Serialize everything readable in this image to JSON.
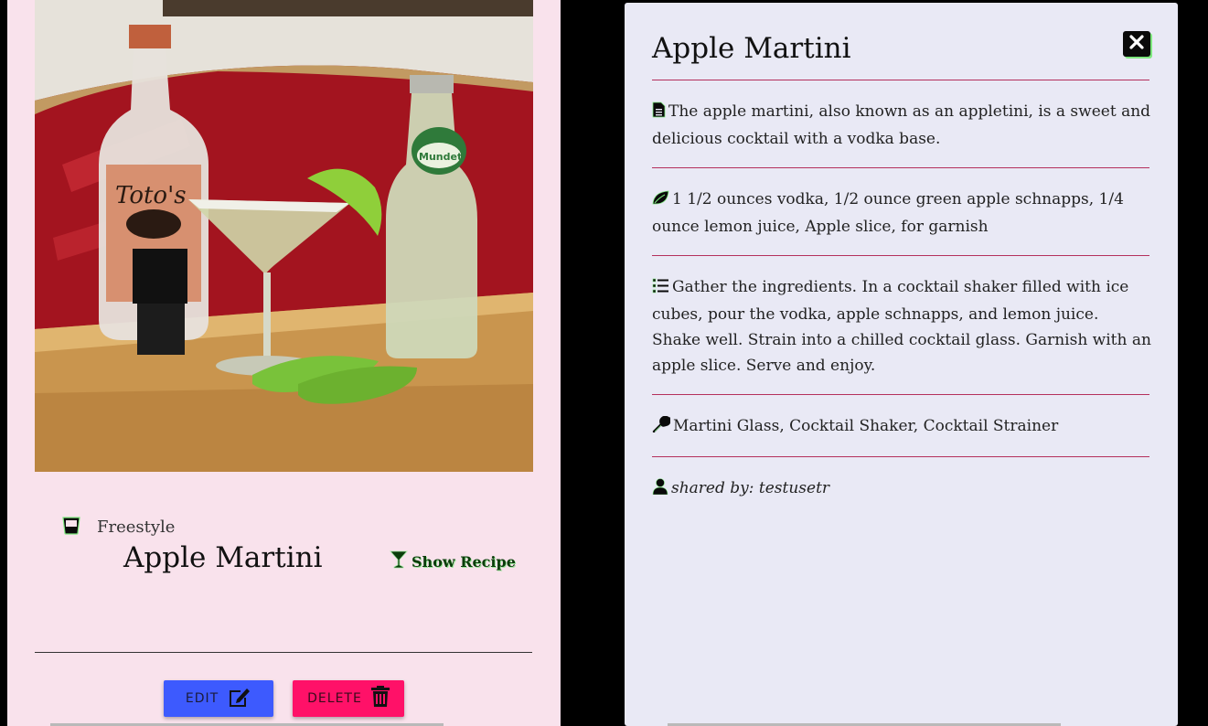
{
  "card": {
    "category": "Freestyle",
    "title": "Apple Martini",
    "show_recipe_label": "Show Recipe",
    "edit_label": "EDIT",
    "delete_label": "DELETE"
  },
  "modal": {
    "title": "Apple Martini",
    "description": "The apple martini, also known as an appletini, is a sweet and delicious cocktail with a vodka base.",
    "ingredients": "1 1/2 ounces vodka, 1/2 ounce green apple schnapps, 1/4 ounce lemon juice, Apple slice, for garnish",
    "instructions": "Gather the ingredients. In a cocktail shaker filled with ice cubes, pour the vodka, apple schnapps, and lemon juice. Shake well. Strain into a chilled cocktail glass. Garnish with an apple slice. Serve and enjoy.",
    "tools": "Martini Glass, Cocktail Shaker, Cocktail Strainer",
    "shared_by": "shared by: testusetr"
  },
  "icons": {
    "category": "glass-icon",
    "show_recipe": "martini-glass-icon",
    "edit": "edit-icon",
    "delete": "trash-icon",
    "close": "close-icon",
    "description": "file-text-icon",
    "ingredients": "leaf-icon",
    "instructions": "list-icon",
    "tools": "wrench-icon",
    "user": "user-icon"
  },
  "colors": {
    "card_bg": "#f9e2ec",
    "modal_bg": "#e9e9f5",
    "edit_button": "#3d5afe",
    "delete_button": "#ff1168",
    "divider_accent": "#b4305c",
    "icon_glow": "#7ee87e"
  }
}
